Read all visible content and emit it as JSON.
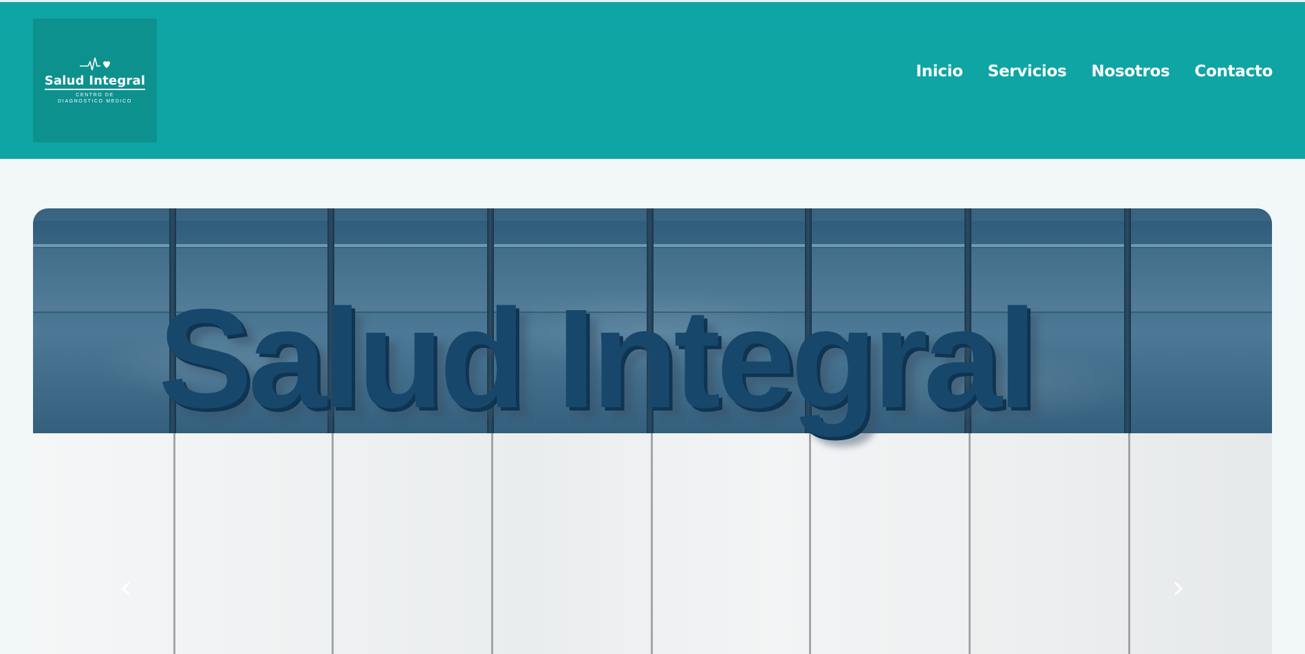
{
  "brand": {
    "logo_title": "Salud Integral",
    "logo_subtitle": "CENTRO DE DIAGNOSTICO MEDICO",
    "logo_icon": "heartbeat-icon",
    "colors": {
      "header": "#0ea5a4",
      "logo_bg": "#0d918f",
      "sign": "#17476b"
    }
  },
  "nav": {
    "items": [
      {
        "label": "Inicio"
      },
      {
        "label": "Servicios"
      },
      {
        "label": "Nosotros"
      },
      {
        "label": "Contacto"
      }
    ]
  },
  "carousel": {
    "slide_text": "Salud Integral",
    "prev_icon": "chevron-left-icon",
    "next_icon": "chevron-right-icon",
    "prev_glyph": "‹",
    "next_glyph": "›"
  }
}
